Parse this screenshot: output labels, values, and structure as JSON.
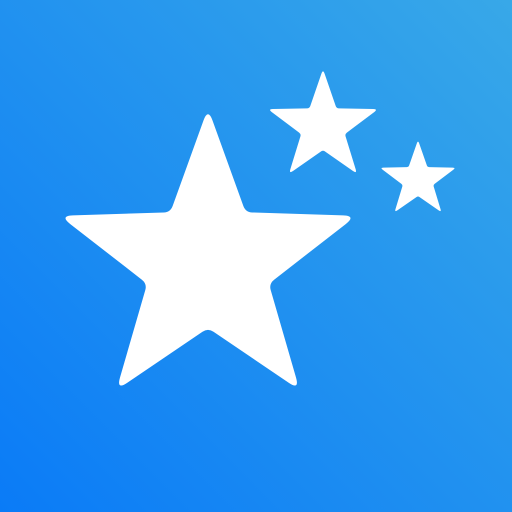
{
  "app_icon": {
    "name": "stars-app-icon",
    "background": {
      "gradient_start": "#0A7BF7",
      "gradient_end": "#38A8E8"
    },
    "stars": [
      {
        "name": "large-star-icon",
        "color": "#FFFFFF"
      },
      {
        "name": "medium-star-icon",
        "color": "#FFFFFF"
      },
      {
        "name": "small-star-icon",
        "color": "#FFFFFF"
      }
    ]
  }
}
